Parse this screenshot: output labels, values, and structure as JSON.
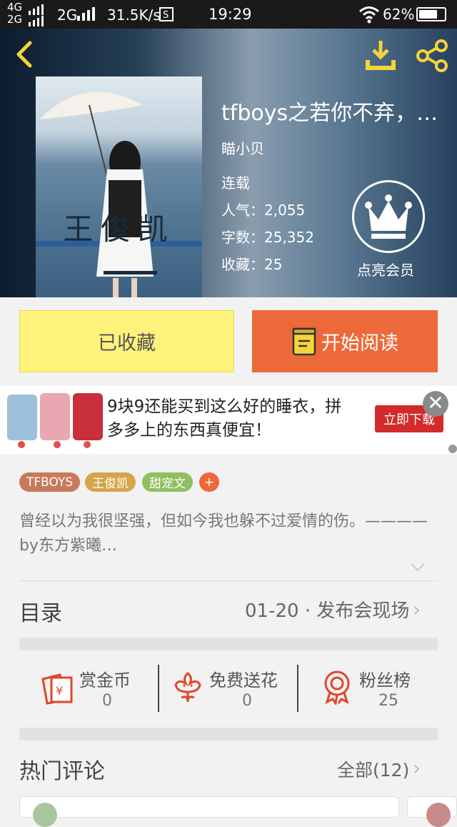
{
  "status": {
    "signal_top": "4G",
    "signal_bottom": "2G",
    "net2": "2G",
    "speed": "31.5K/s",
    "time": "19:29",
    "battery": "62%"
  },
  "book": {
    "cover_text": "王俊凯",
    "title": "tfboys之若你不弃，…",
    "author": "瞄小贝",
    "status": "连载",
    "popularity": "人气：2,055",
    "words": "字数：25,352",
    "favorites": "收藏：25",
    "member_label": "点亮会员"
  },
  "actions": {
    "favorited": "已收藏",
    "read": "开始阅读"
  },
  "ad": {
    "text": "9块9还能买到这么好的睡衣，拼多多上的东西真便宜！",
    "cta": "立即下载",
    "close": "✕"
  },
  "tags": [
    {
      "label": "TFBOYS",
      "color": "#c77a5a"
    },
    {
      "label": "王俊凯",
      "color": "#d6a44a"
    },
    {
      "label": "甜宠文",
      "color": "#8fbf5f"
    },
    {
      "label": "+",
      "color": "#ec6a3a"
    }
  ],
  "intro": "曾经以为我很坚强，但如今我也躲不过爱情的伤。————by东方紫曦…",
  "toc": {
    "label": "目录",
    "latest": "01-20 · 发布会现场"
  },
  "stats": [
    {
      "label": "赏金币",
      "value": "0",
      "icon": "red-envelope-icon"
    },
    {
      "label": "免费送花",
      "value": "0",
      "icon": "flower-icon"
    },
    {
      "label": "粉丝榜",
      "value": "25",
      "icon": "medal-icon"
    }
  ],
  "comments": {
    "label": "热门评论",
    "all": "全部(12)"
  },
  "colors": {
    "accent": "#ec6a3a",
    "fav_bg": "#fdf37a",
    "icon_red": "#e0452b"
  }
}
